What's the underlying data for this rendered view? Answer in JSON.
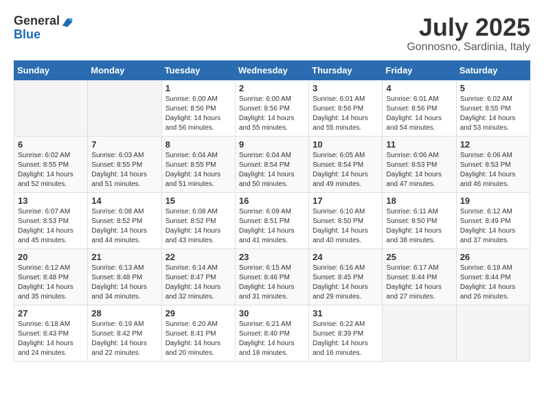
{
  "logo": {
    "general": "General",
    "blue": "Blue"
  },
  "header": {
    "month": "July 2025",
    "location": "Gonnosno, Sardinia, Italy"
  },
  "weekdays": [
    "Sunday",
    "Monday",
    "Tuesday",
    "Wednesday",
    "Thursday",
    "Friday",
    "Saturday"
  ],
  "weeks": [
    [
      {
        "day": "",
        "info": ""
      },
      {
        "day": "",
        "info": ""
      },
      {
        "day": "1",
        "info": "Sunrise: 6:00 AM\nSunset: 8:56 PM\nDaylight: 14 hours and 56 minutes."
      },
      {
        "day": "2",
        "info": "Sunrise: 6:00 AM\nSunset: 8:56 PM\nDaylight: 14 hours and 55 minutes."
      },
      {
        "day": "3",
        "info": "Sunrise: 6:01 AM\nSunset: 8:56 PM\nDaylight: 14 hours and 55 minutes."
      },
      {
        "day": "4",
        "info": "Sunrise: 6:01 AM\nSunset: 8:56 PM\nDaylight: 14 hours and 54 minutes."
      },
      {
        "day": "5",
        "info": "Sunrise: 6:02 AM\nSunset: 8:55 PM\nDaylight: 14 hours and 53 minutes."
      }
    ],
    [
      {
        "day": "6",
        "info": "Sunrise: 6:02 AM\nSunset: 8:55 PM\nDaylight: 14 hours and 52 minutes."
      },
      {
        "day": "7",
        "info": "Sunrise: 6:03 AM\nSunset: 8:55 PM\nDaylight: 14 hours and 51 minutes."
      },
      {
        "day": "8",
        "info": "Sunrise: 6:04 AM\nSunset: 8:55 PM\nDaylight: 14 hours and 51 minutes."
      },
      {
        "day": "9",
        "info": "Sunrise: 6:04 AM\nSunset: 8:54 PM\nDaylight: 14 hours and 50 minutes."
      },
      {
        "day": "10",
        "info": "Sunrise: 6:05 AM\nSunset: 8:54 PM\nDaylight: 14 hours and 49 minutes."
      },
      {
        "day": "11",
        "info": "Sunrise: 6:06 AM\nSunset: 8:53 PM\nDaylight: 14 hours and 47 minutes."
      },
      {
        "day": "12",
        "info": "Sunrise: 6:06 AM\nSunset: 8:53 PM\nDaylight: 14 hours and 46 minutes."
      }
    ],
    [
      {
        "day": "13",
        "info": "Sunrise: 6:07 AM\nSunset: 8:53 PM\nDaylight: 14 hours and 45 minutes."
      },
      {
        "day": "14",
        "info": "Sunrise: 6:08 AM\nSunset: 8:52 PM\nDaylight: 14 hours and 44 minutes."
      },
      {
        "day": "15",
        "info": "Sunrise: 6:08 AM\nSunset: 8:52 PM\nDaylight: 14 hours and 43 minutes."
      },
      {
        "day": "16",
        "info": "Sunrise: 6:09 AM\nSunset: 8:51 PM\nDaylight: 14 hours and 41 minutes."
      },
      {
        "day": "17",
        "info": "Sunrise: 6:10 AM\nSunset: 8:50 PM\nDaylight: 14 hours and 40 minutes."
      },
      {
        "day": "18",
        "info": "Sunrise: 6:11 AM\nSunset: 8:50 PM\nDaylight: 14 hours and 38 minutes."
      },
      {
        "day": "19",
        "info": "Sunrise: 6:12 AM\nSunset: 8:49 PM\nDaylight: 14 hours and 37 minutes."
      }
    ],
    [
      {
        "day": "20",
        "info": "Sunrise: 6:12 AM\nSunset: 8:48 PM\nDaylight: 14 hours and 35 minutes."
      },
      {
        "day": "21",
        "info": "Sunrise: 6:13 AM\nSunset: 8:48 PM\nDaylight: 14 hours and 34 minutes."
      },
      {
        "day": "22",
        "info": "Sunrise: 6:14 AM\nSunset: 8:47 PM\nDaylight: 14 hours and 32 minutes."
      },
      {
        "day": "23",
        "info": "Sunrise: 6:15 AM\nSunset: 8:46 PM\nDaylight: 14 hours and 31 minutes."
      },
      {
        "day": "24",
        "info": "Sunrise: 6:16 AM\nSunset: 8:45 PM\nDaylight: 14 hours and 29 minutes."
      },
      {
        "day": "25",
        "info": "Sunrise: 6:17 AM\nSunset: 8:44 PM\nDaylight: 14 hours and 27 minutes."
      },
      {
        "day": "26",
        "info": "Sunrise: 6:18 AM\nSunset: 8:44 PM\nDaylight: 14 hours and 26 minutes."
      }
    ],
    [
      {
        "day": "27",
        "info": "Sunrise: 6:18 AM\nSunset: 8:43 PM\nDaylight: 14 hours and 24 minutes."
      },
      {
        "day": "28",
        "info": "Sunrise: 6:19 AM\nSunset: 8:42 PM\nDaylight: 14 hours and 22 minutes."
      },
      {
        "day": "29",
        "info": "Sunrise: 6:20 AM\nSunset: 8:41 PM\nDaylight: 14 hours and 20 minutes."
      },
      {
        "day": "30",
        "info": "Sunrise: 6:21 AM\nSunset: 8:40 PM\nDaylight: 14 hours and 18 minutes."
      },
      {
        "day": "31",
        "info": "Sunrise: 6:22 AM\nSunset: 8:39 PM\nDaylight: 14 hours and 16 minutes."
      },
      {
        "day": "",
        "info": ""
      },
      {
        "day": "",
        "info": ""
      }
    ]
  ]
}
